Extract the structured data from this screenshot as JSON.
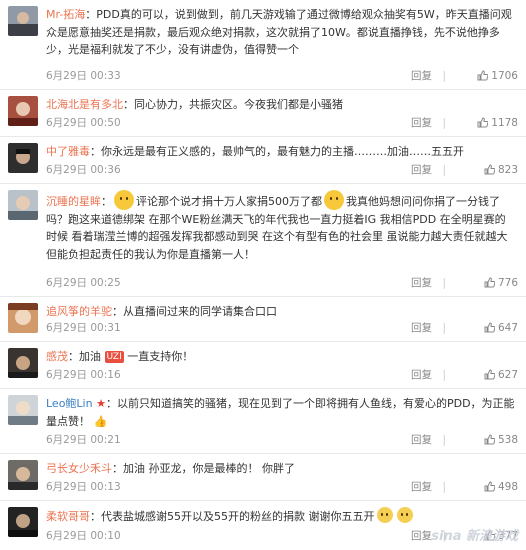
{
  "comments": [
    {
      "name": "Mr-拓海",
      "name_color": "orange",
      "text": "：PDD真的可以，说到做到，前几天游戏输了通过微博给观众抽奖有5W，昨天直播问观众是愿意抽奖还是捐款，最后观众绝对捐款，这次就捐了10W。都说直播挣钱，先不说他挣多少，光是福利就发了不少，没有讲虚伪，值得赞一个",
      "time": "6月29日 00:33",
      "reply": "回复",
      "likes": "1706"
    },
    {
      "name": "北海北是有多北",
      "name_color": "orange",
      "text": "：同心协力，共振灾区。今夜我们都是小骚猪",
      "time": "6月29日 00:50",
      "reply": "回复",
      "likes": "1178"
    },
    {
      "name": "中了雅毒",
      "name_color": "orange",
      "text": "：你永远是最有正义感的，最帅气的，最有魅力的主播………加油……五五开",
      "time": "6月29日 00:36",
      "reply": "回复",
      "likes": "823"
    },
    {
      "name": "沉睡的星眸",
      "name_color": "orange",
      "text_a": "：",
      "text_b": "评论那个说才捐十万人家捐500万了都",
      "text_c": "我真他妈想问问你捐了一分钱了吗？跑这来道德绑架 在那个WE粉丝满天飞的年代我也一直力挺着IG 我相信PDD 在全明星赛的时候 看着瑞滢兰博的超强发挥我都感动到哭 在这个有型有色的社会里 虽说能力越大责任就越大 但能负担起责任的我认为你是直播第一人！",
      "time": "6月29日 00:25",
      "reply": "回复",
      "likes": "776"
    },
    {
      "name": "追风筝的羊驼",
      "name_color": "orange",
      "text": "：从直播间过来的同学请集合口口",
      "time": "6月29日 00:31",
      "reply": "回复",
      "likes": "647"
    },
    {
      "name": "感茂",
      "name_color": "orange",
      "text_a": "：加油",
      "badge": "UZI",
      "text_b": "一直支持你！",
      "time": "6月29日 00:16",
      "reply": "回复",
      "likes": "627"
    },
    {
      "name": "Leo鲍Lin",
      "name_color": "blue",
      "text": "：以前只知道搞笑的骚猪，现在见到了一个即将拥有人鱼线，有爱心的PDD，为正能量点赞！",
      "time": "6月29日 00:21",
      "reply": "回复",
      "likes": "538"
    },
    {
      "name": "弓长女少禾斗",
      "name_color": "orange",
      "text": "：加油 孙亚龙，你是最棒的！   你胖了",
      "time": "6月29日 00:13",
      "reply": "回复",
      "likes": "498"
    },
    {
      "name": "柔软哥哥",
      "name_color": "orange",
      "text": "：代表盐城感谢55开以及55开的粉丝的捐款 谢谢你五五开",
      "time": "6月29日 00:10",
      "reply": "回复",
      "likes": "377"
    }
  ],
  "watermark": "sina 新浪游戏"
}
